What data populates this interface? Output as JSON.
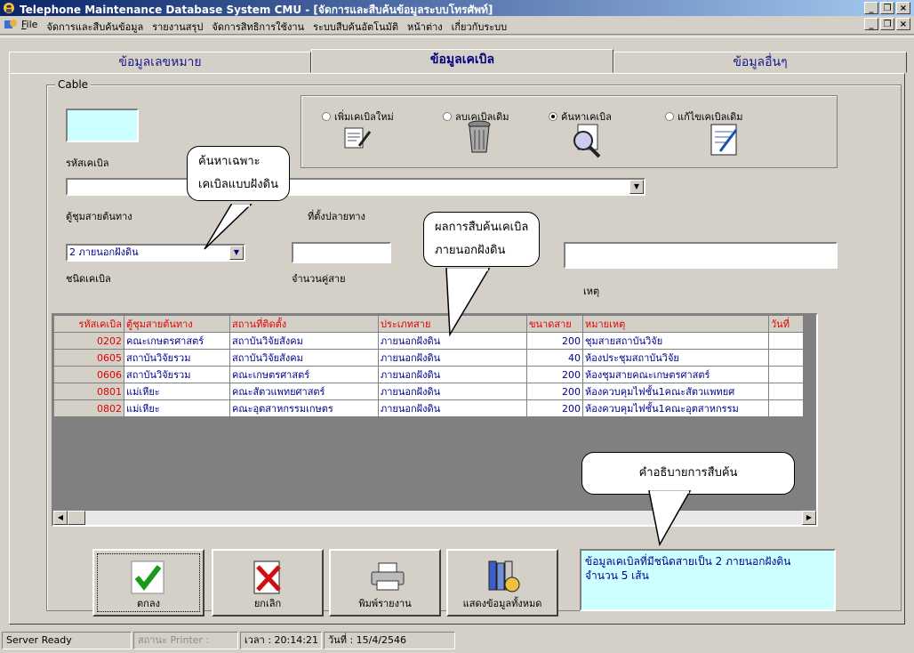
{
  "window": {
    "title": "Telephone Maintenance Database System CMU - [จัดการและสืบค้นข้อมูลระบบโทรศัพท์]"
  },
  "menu": {
    "items": [
      "File",
      "จัดการและสืบค้นข้อมูล",
      "รายงานสรุป",
      "จัดการสิทธิการใช้งาน",
      "ระบบสืบค้นอัตโนมัติ",
      "หน้าต่าง",
      "เกี่ยวกับระบบ"
    ]
  },
  "tabs": {
    "t1": "ข้อมูลเลขหมาย",
    "t2": "ข้อมูลเคเบิล",
    "t3": "ข้อมูลอื่นๆ"
  },
  "group": {
    "legend": "Cable"
  },
  "fields": {
    "cable_code_label": "รหัสเคเบิล",
    "cable_code_value": "",
    "origin_label": "ตู้ชุมสายต้นทาง",
    "dest_label": "ที่ตั้งปลายทาง",
    "type_label": "ชนิดเคเบิล",
    "type_value": "2 ภายนอกฝังดิน",
    "pairs_label": "จำนวนคู่สาย",
    "note_label": "เหตุ"
  },
  "radios": [
    {
      "label": "เพิ่มเคเบิลใหม่",
      "icon": "document-pen-icon"
    },
    {
      "label": "ลบเคเบิลเดิม",
      "icon": "trash-can-icon"
    },
    {
      "label": "ค้นหาเคเบิล",
      "icon": "magnifier-icon"
    },
    {
      "label": "แก้ไขเคเบิลเดิม",
      "icon": "edit-document-icon"
    }
  ],
  "table": {
    "headers": [
      "รหัสเคเบิล",
      "ตู้ชุมสายต้นทาง",
      "สถานที่ติดตั้ง",
      "ประเภทสาย",
      "ขนาดสาย",
      "หมายเหตุ",
      "วันที่"
    ],
    "rows": [
      [
        "0202",
        "คณะเกษตรศาสตร์",
        "สถาบันวิจัยสังคม",
        "ภายนอกฝังดิน",
        "200",
        "ชุมสายสถาบันวิจัย"
      ],
      [
        "0605",
        "สถาบันวิจัยรวม",
        "สถาบันวิจัยสังคม",
        "ภายนอกฝังดิน",
        "40",
        "ห้องประชุมสถาบันวิจัย"
      ],
      [
        "0606",
        "สถาบันวิจัยรวม",
        "คณะเกษตรศาสตร์",
        "ภายนอกฝังดิน",
        "200",
        "ห้องชุมสายคณะเกษตรศาสตร์"
      ],
      [
        "0801",
        "แม่เหียะ",
        "คณะสัตวแพทยศาสตร์",
        "ภายนอกฝังดิน",
        "200",
        "ห้องควบคุมไฟชั้น1คณะสัตวแพทยศ"
      ],
      [
        "0802",
        "แม่เหียะ",
        "คณะอุตสาหกรรมเกษตร",
        "ภายนอกฝังดิน",
        "200",
        "ห้องควบคุมไฟชั้น1คณะอุตสาหกรรม"
      ]
    ]
  },
  "buttons": {
    "ok": "ตกลง",
    "cancel": "ยกเลิก",
    "print": "พิมพ์รายงาน",
    "show_all": "แสดงข้อมูลทั้งหมด"
  },
  "info": {
    "line1": "ข้อมูลเคเบิลที่มีชนิดสายเป็น 2 ภายนอกฝังดิน",
    "line2": "จำนวน 5 เส้น"
  },
  "callouts": {
    "c1_line1": "ค้นหาเฉพาะ",
    "c1_line2": "เคเบิลแบบฝังดิน",
    "c2_line1": "ผลการสืบค้นเคเบิล",
    "c2_line2": "ภายนอกฝังดิน",
    "c3": "คำอธิบายการสืบค้น"
  },
  "status": {
    "server": "Server Ready",
    "printer": "สถานะ Printer :",
    "time": "เวลา : 20:14:21",
    "date": "วันที่ : 15/4/2546"
  }
}
